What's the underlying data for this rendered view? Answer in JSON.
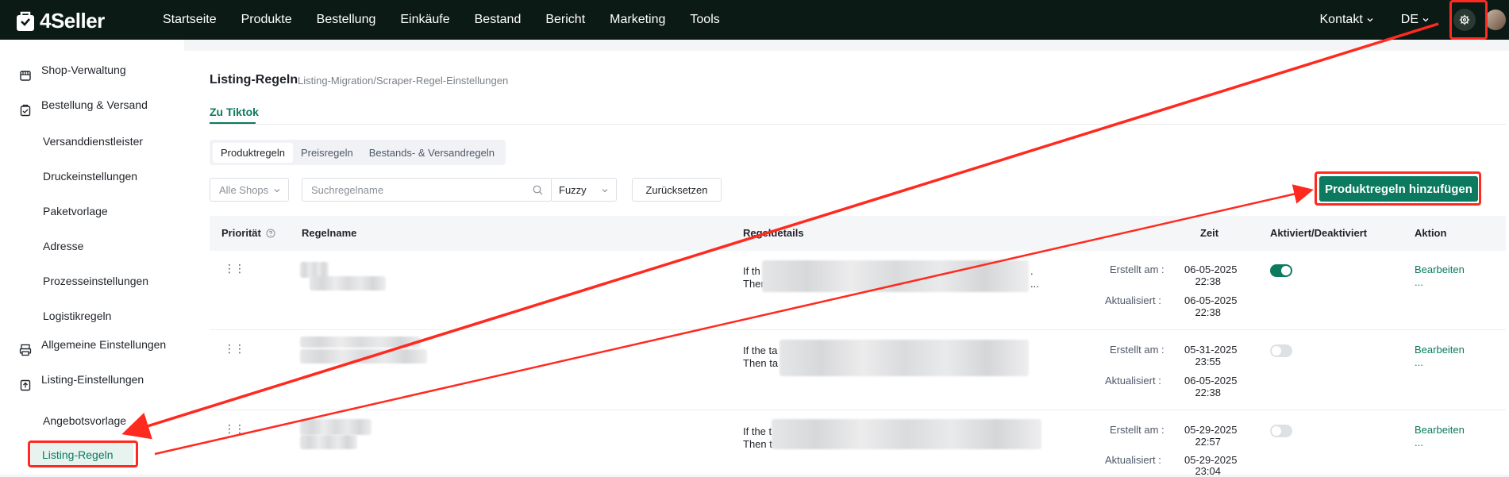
{
  "brand": {
    "name": "4Seller"
  },
  "nav": [
    "Startseite",
    "Produkte",
    "Bestellung",
    "Einkäufe",
    "Bestand",
    "Bericht",
    "Marketing",
    "Tools"
  ],
  "topright": {
    "contact": "Kontakt",
    "language": "DE"
  },
  "sidebar": {
    "sections": [
      {
        "label": "Shop-Verwaltung",
        "icon": "store-icon"
      },
      {
        "label": "Bestellung & Versand",
        "icon": "order-icon"
      },
      {
        "label": "Allgemeine Einstellungen",
        "icon": "printer-icon"
      },
      {
        "label": "Listing-Einstellungen",
        "icon": "upload-icon"
      }
    ],
    "sub_shipping": [
      "Versanddienstleister",
      "Druckeinstellungen",
      "Paketvorlage",
      "Adresse",
      "Prozesseinstellungen",
      "Logistikregeln"
    ],
    "sub_listing": [
      "Angebotsvorlage",
      "Listing-Regeln"
    ]
  },
  "page": {
    "title": "Listing-Regeln",
    "subtitle": "Listing-Migration/Scraper-Regel-Einstellungen",
    "tab": "Zu Tiktok",
    "segments": [
      "Produktregeln",
      "Preisregeln",
      "Bestands- & Versandregeln"
    ]
  },
  "filters": {
    "shop": "Alle Shops",
    "search_placeholder": "Suchregelname",
    "mode": "Fuzzy",
    "reset": "Zurücksetzen",
    "add": "Produktregeln hinzufügen"
  },
  "table": {
    "headers": [
      "Priorität",
      "Regelname",
      "Regeldetails",
      "Zeit",
      "Aktiviert/Deaktiviert",
      "Aktion"
    ],
    "rows": [
      {
        "detail1": "If th",
        "detail2": "Then",
        "detail1_end": ".",
        "detail2_end": "...",
        "created_label": "Erstellt am :",
        "created_date": "06-05-2025",
        "created_time": "22:38",
        "updated_label": "Aktualisiert :",
        "updated_date": "06-05-2025",
        "updated_time": "22:38",
        "enabled": true,
        "action": "Bearbeiten",
        "more": "..."
      },
      {
        "detail1": "If the ta",
        "detail2": "Then ta",
        "detail1_end": "",
        "detail2_end": "",
        "created_label": "Erstellt am :",
        "created_date": "05-31-2025",
        "created_time": "23:55",
        "updated_label": "Aktualisiert :",
        "updated_date": "06-05-2025",
        "updated_time": "22:38",
        "enabled": false,
        "action": "Bearbeiten",
        "more": "..."
      },
      {
        "detail1": "If the t",
        "detail2": "Then ta",
        "detail1_end": "",
        "detail2_end": "",
        "created_label": "Erstellt am :",
        "created_date": "05-29-2025",
        "created_time": "22:57",
        "updated_label": "Aktualisiert :",
        "updated_date": "05-29-2025",
        "updated_time": "23:04",
        "enabled": false,
        "action": "Bearbeiten",
        "more": "..."
      }
    ]
  },
  "colors": {
    "accent": "#0b7a5f",
    "topbar": "#0b1a14",
    "annotation": "#ff2a1f"
  }
}
